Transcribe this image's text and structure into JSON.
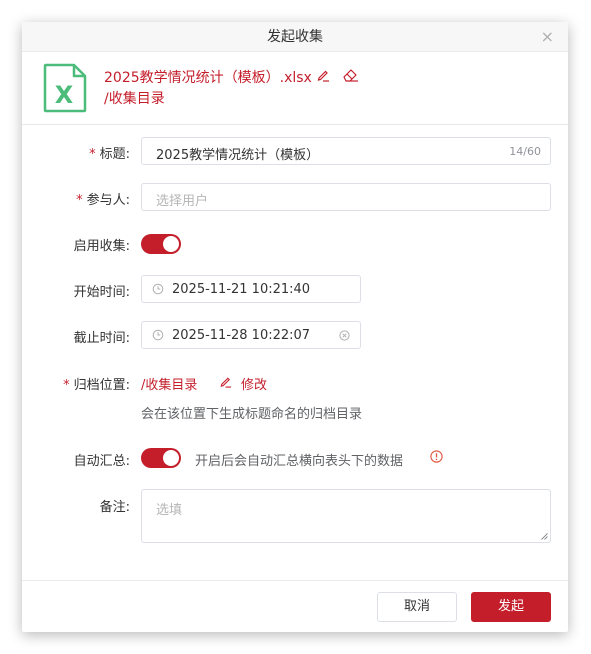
{
  "dialog": {
    "title": "发起收集",
    "close_glyph": "×"
  },
  "file": {
    "icon": "excel-file-icon",
    "icon_letter": "X",
    "name": "2025教学情况统计（模板）.xlsx",
    "path": "/收集目录"
  },
  "form": {
    "title_label": "标题:",
    "title_value": "2025教学情况统计（模板）",
    "title_counter": "14/60",
    "participants_label": "参与人:",
    "participants_placeholder": "选择用户",
    "enable_label": "启用收集:",
    "enable_on": true,
    "start_label": "开始时间:",
    "start_value": "2025-11-21 10:21:40",
    "end_label": "截止时间:",
    "end_value": "2025-11-28 10:22:07",
    "archive_label": "归档位置:",
    "archive_path": "/收集目录",
    "archive_modify": "修改",
    "archive_hint": "会在该位置下生成标题命名的归档目录",
    "summary_label": "自动汇总:",
    "summary_on": true,
    "summary_hint": "开启后会自动汇总横向表头下的数据",
    "remark_label": "备注:",
    "remark_placeholder": "选填",
    "required_mark": "*"
  },
  "footer": {
    "cancel": "取消",
    "submit": "发起"
  },
  "colors": {
    "accent": "#c41e2b",
    "excel_green": "#4cbc7a"
  }
}
